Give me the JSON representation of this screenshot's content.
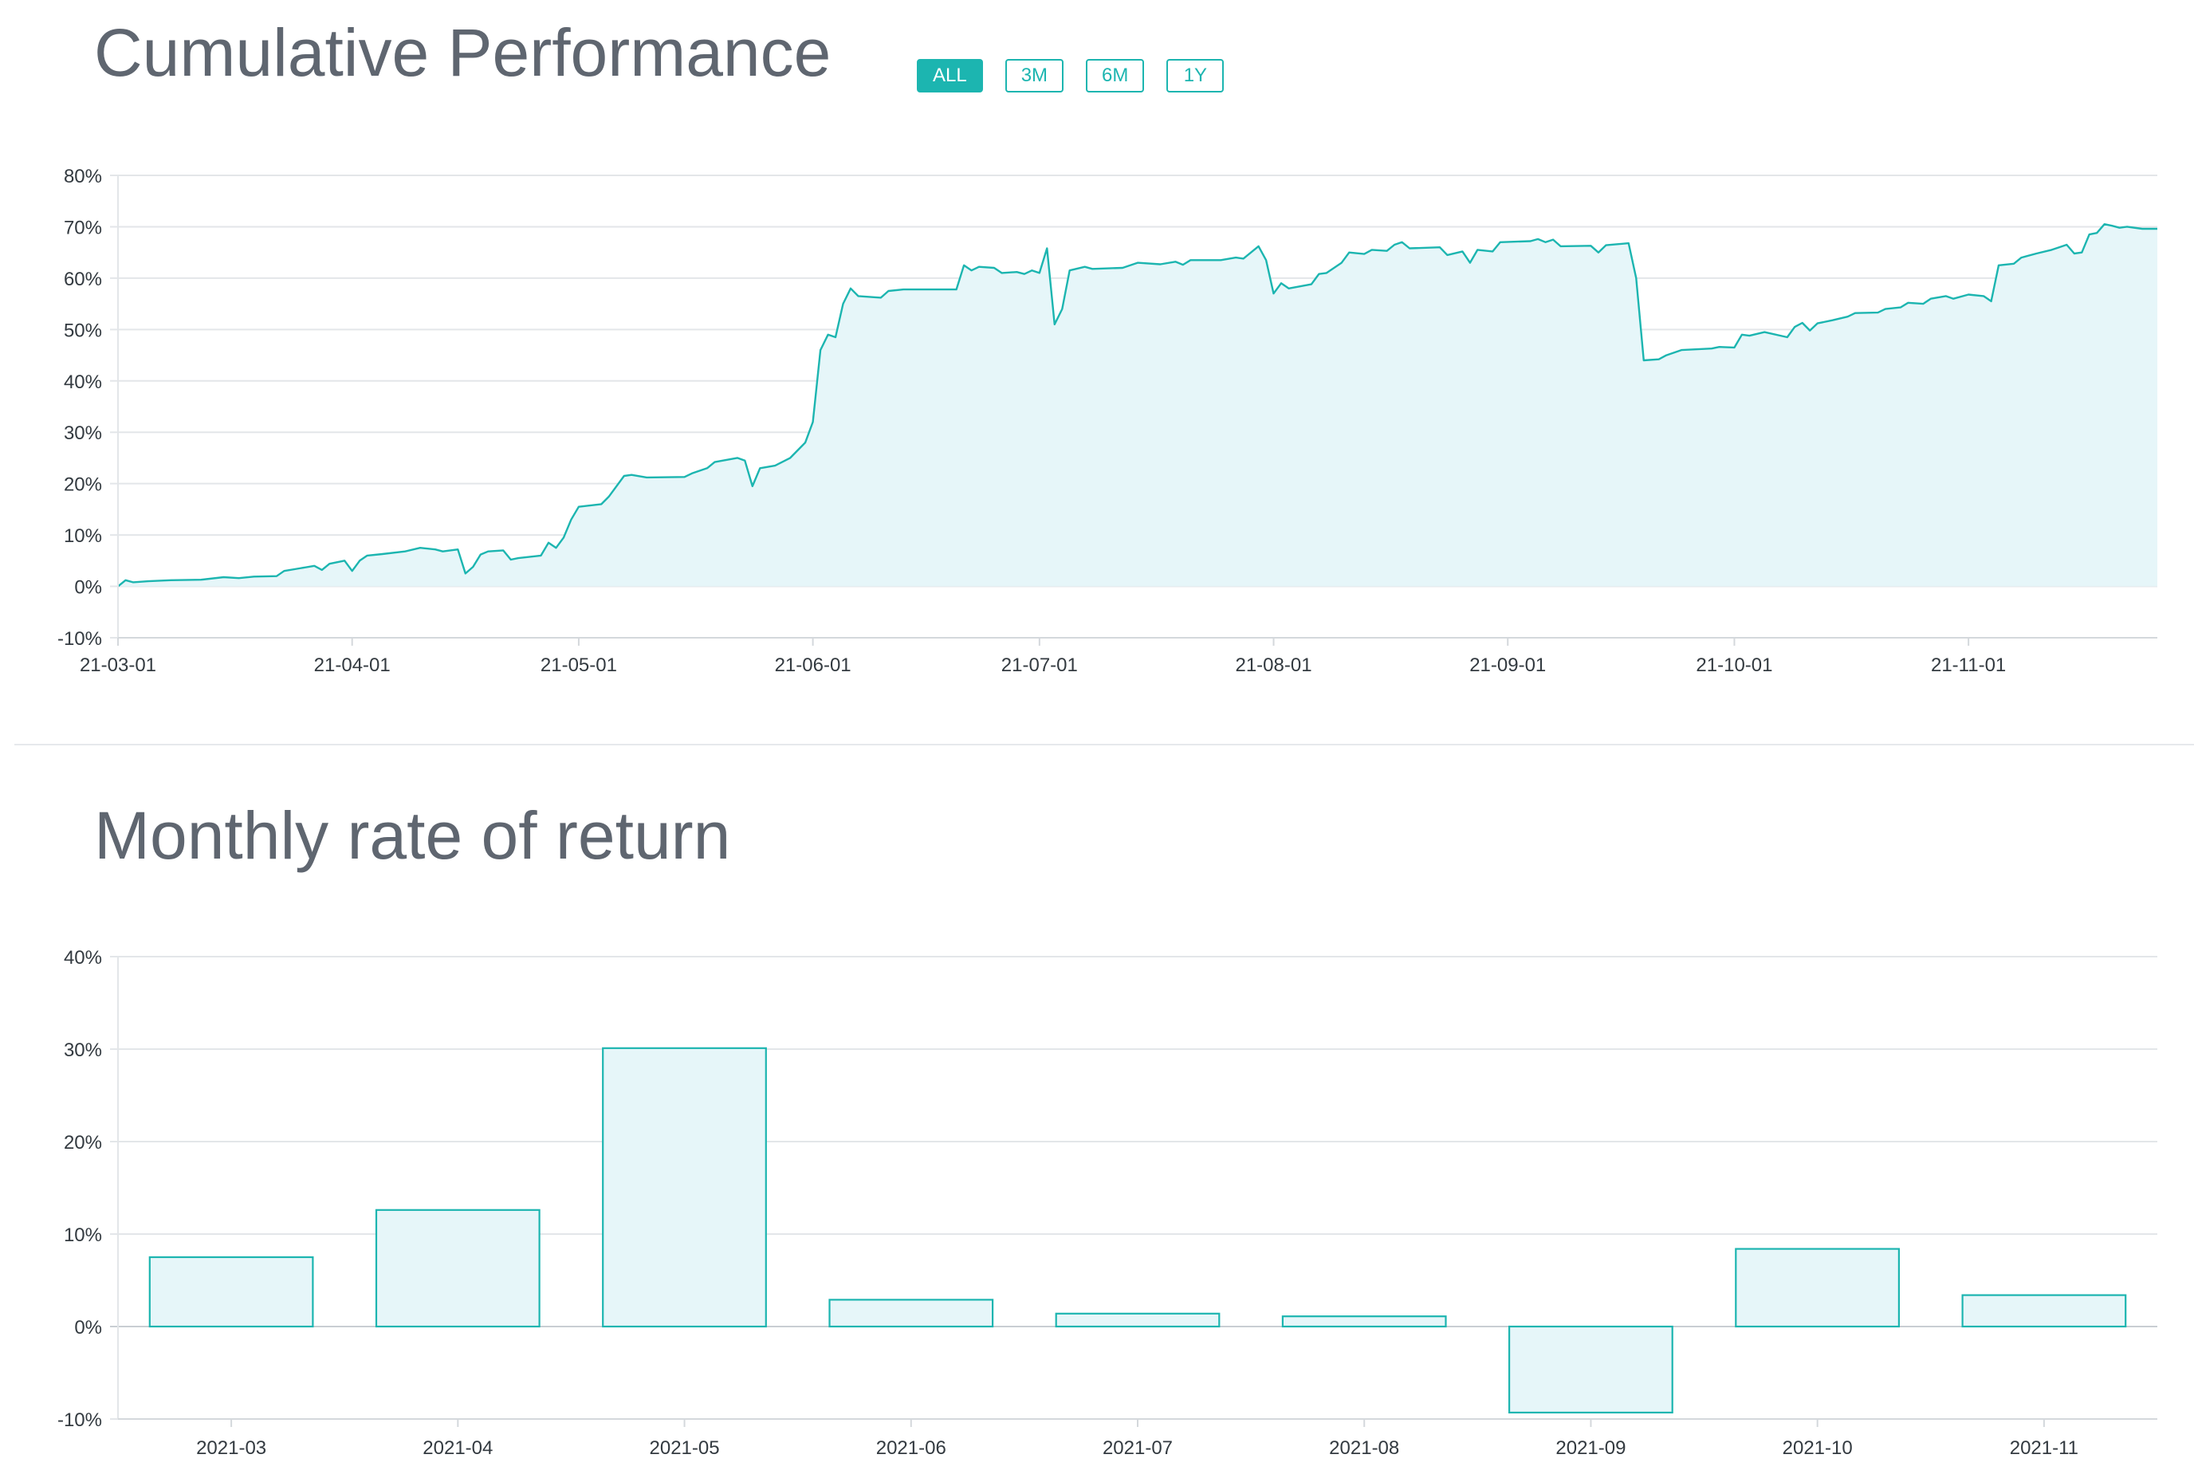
{
  "cumulative": {
    "title": "Cumulative Performance",
    "range_buttons": [
      {
        "label": "ALL",
        "active": true
      },
      {
        "label": "3M",
        "active": false
      },
      {
        "label": "6M",
        "active": false
      },
      {
        "label": "1Y",
        "active": false
      }
    ]
  },
  "monthly": {
    "title": "Monthly rate of return"
  },
  "colors": {
    "accent": "#1cb5b0",
    "fill": "#e6f6f9",
    "grid": "#e3e6e9",
    "title": "#5f6670"
  },
  "chart_data": [
    {
      "type": "area",
      "title": "",
      "xlabel": "",
      "ylabel": "",
      "ylim": [
        -10,
        80
      ],
      "y_unit": "%",
      "y_ticks": [
        -10,
        0,
        10,
        20,
        30,
        40,
        50,
        60,
        70,
        80
      ],
      "x_ticks": [
        "21-03-01",
        "21-04-01",
        "21-05-01",
        "21-06-01",
        "21-07-01",
        "21-08-01",
        "21-09-01",
        "21-10-01",
        "21-11-01"
      ],
      "x_tick_dates": [
        "2021-03-01",
        "2021-04-01",
        "2021-05-01",
        "2021-06-01",
        "2021-07-01",
        "2021-08-01",
        "2021-09-01",
        "2021-10-01",
        "2021-11-01"
      ],
      "x_range": [
        "2021-03-01",
        "2021-11-26"
      ],
      "grid": true,
      "legend": "none",
      "series": [
        {
          "points": [
            [
              "2021-03-01",
              0
            ],
            [
              "2021-03-02",
              1.2
            ],
            [
              "2021-03-03",
              0.8
            ],
            [
              "2021-03-05",
              1.0
            ],
            [
              "2021-03-08",
              1.2
            ],
            [
              "2021-03-12",
              1.3
            ],
            [
              "2021-03-15",
              1.8
            ],
            [
              "2021-03-17",
              1.6
            ],
            [
              "2021-03-19",
              1.9
            ],
            [
              "2021-03-22",
              2.0
            ],
            [
              "2021-03-23",
              3.0
            ],
            [
              "2021-03-25",
              3.5
            ],
            [
              "2021-03-27",
              4.0
            ],
            [
              "2021-03-28",
              3.2
            ],
            [
              "2021-03-29",
              4.4
            ],
            [
              "2021-03-31",
              5.0
            ],
            [
              "2021-04-01",
              3.0
            ],
            [
              "2021-04-02",
              5.0
            ],
            [
              "2021-04-03",
              6.0
            ],
            [
              "2021-04-05",
              6.3
            ],
            [
              "2021-04-08",
              6.8
            ],
            [
              "2021-04-10",
              7.5
            ],
            [
              "2021-04-12",
              7.2
            ],
            [
              "2021-04-13",
              6.8
            ],
            [
              "2021-04-15",
              7.2
            ],
            [
              "2021-04-16",
              2.5
            ],
            [
              "2021-04-17",
              3.8
            ],
            [
              "2021-04-18",
              6.2
            ],
            [
              "2021-04-19",
              6.8
            ],
            [
              "2021-04-21",
              7.0
            ],
            [
              "2021-04-22",
              5.2
            ],
            [
              "2021-04-23",
              5.5
            ],
            [
              "2021-04-26",
              6.0
            ],
            [
              "2021-04-27",
              8.5
            ],
            [
              "2021-04-28",
              7.5
            ],
            [
              "2021-04-29",
              9.5
            ],
            [
              "2021-04-30",
              13.0
            ],
            [
              "2021-05-01",
              15.5
            ],
            [
              "2021-05-04",
              16.0
            ],
            [
              "2021-05-05",
              17.5
            ],
            [
              "2021-05-07",
              21.5
            ],
            [
              "2021-05-08",
              21.7
            ],
            [
              "2021-05-10",
              21.2
            ],
            [
              "2021-05-15",
              21.3
            ],
            [
              "2021-05-16",
              22.0
            ],
            [
              "2021-05-18",
              23.0
            ],
            [
              "2021-05-19",
              24.2
            ],
            [
              "2021-05-22",
              25.0
            ],
            [
              "2021-05-23",
              24.5
            ],
            [
              "2021-05-24",
              19.5
            ],
            [
              "2021-05-25",
              23.0
            ],
            [
              "2021-05-27",
              23.5
            ],
            [
              "2021-05-29",
              25.0
            ],
            [
              "2021-05-31",
              28.0
            ],
            [
              "2021-06-01",
              32.0
            ],
            [
              "2021-06-02",
              46.0
            ],
            [
              "2021-06-03",
              49.0
            ],
            [
              "2021-06-04",
              48.5
            ],
            [
              "2021-06-05",
              55.0
            ],
            [
              "2021-06-06",
              58.0
            ],
            [
              "2021-06-07",
              56.5
            ],
            [
              "2021-06-10",
              56.2
            ],
            [
              "2021-06-11",
              57.5
            ],
            [
              "2021-06-13",
              57.8
            ],
            [
              "2021-06-20",
              57.8
            ],
            [
              "2021-06-21",
              62.5
            ],
            [
              "2021-06-22",
              61.5
            ],
            [
              "2021-06-23",
              62.2
            ],
            [
              "2021-06-25",
              62.0
            ],
            [
              "2021-06-26",
              61.0
            ],
            [
              "2021-06-28",
              61.2
            ],
            [
              "2021-06-29",
              60.8
            ],
            [
              "2021-06-30",
              61.5
            ],
            [
              "2021-07-01",
              61.0
            ],
            [
              "2021-07-02",
              65.8
            ],
            [
              "2021-07-03",
              51.0
            ],
            [
              "2021-07-04",
              54.0
            ],
            [
              "2021-07-05",
              61.5
            ],
            [
              "2021-07-07",
              62.2
            ],
            [
              "2021-07-08",
              61.8
            ],
            [
              "2021-07-12",
              62.0
            ],
            [
              "2021-07-14",
              63.0
            ],
            [
              "2021-07-17",
              62.7
            ],
            [
              "2021-07-19",
              63.2
            ],
            [
              "2021-07-20",
              62.6
            ],
            [
              "2021-07-21",
              63.5
            ],
            [
              "2021-07-25",
              63.5
            ],
            [
              "2021-07-27",
              64.0
            ],
            [
              "2021-07-28",
              63.8
            ],
            [
              "2021-07-29",
              65.0
            ],
            [
              "2021-07-30",
              66.2
            ],
            [
              "2021-07-31",
              63.5
            ],
            [
              "2021-08-01",
              57.0
            ],
            [
              "2021-08-02",
              59.0
            ],
            [
              "2021-08-03",
              58.0
            ],
            [
              "2021-08-06",
              58.8
            ],
            [
              "2021-08-07",
              60.8
            ],
            [
              "2021-08-08",
              61.0
            ],
            [
              "2021-08-10",
              63.0
            ],
            [
              "2021-08-11",
              65.0
            ],
            [
              "2021-08-13",
              64.7
            ],
            [
              "2021-08-14",
              65.5
            ],
            [
              "2021-08-16",
              65.3
            ],
            [
              "2021-08-17",
              66.5
            ],
            [
              "2021-08-18",
              67.0
            ],
            [
              "2021-08-19",
              65.8
            ],
            [
              "2021-08-23",
              66.0
            ],
            [
              "2021-08-24",
              64.5
            ],
            [
              "2021-08-26",
              65.2
            ],
            [
              "2021-08-27",
              63.0
            ],
            [
              "2021-08-28",
              65.5
            ],
            [
              "2021-08-30",
              65.2
            ],
            [
              "2021-08-31",
              67.0
            ],
            [
              "2021-09-04",
              67.2
            ],
            [
              "2021-09-05",
              67.6
            ],
            [
              "2021-09-06",
              67.0
            ],
            [
              "2021-09-07",
              67.5
            ],
            [
              "2021-09-08",
              66.2
            ],
            [
              "2021-09-12",
              66.3
            ],
            [
              "2021-09-13",
              65.0
            ],
            [
              "2021-09-14",
              66.4
            ],
            [
              "2021-09-17",
              66.8
            ],
            [
              "2021-09-18",
              60.0
            ],
            [
              "2021-09-19",
              44.0
            ],
            [
              "2021-09-21",
              44.2
            ],
            [
              "2021-09-22",
              45.0
            ],
            [
              "2021-09-24",
              46.0
            ],
            [
              "2021-09-28",
              46.3
            ],
            [
              "2021-09-29",
              46.6
            ],
            [
              "2021-10-01",
              46.5
            ],
            [
              "2021-10-02",
              49.0
            ],
            [
              "2021-10-03",
              48.8
            ],
            [
              "2021-10-05",
              49.5
            ],
            [
              "2021-10-08",
              48.5
            ],
            [
              "2021-10-09",
              50.5
            ],
            [
              "2021-10-10",
              51.3
            ],
            [
              "2021-10-11",
              49.8
            ],
            [
              "2021-10-12",
              51.2
            ],
            [
              "2021-10-14",
              51.8
            ],
            [
              "2021-10-16",
              52.5
            ],
            [
              "2021-10-17",
              53.2
            ],
            [
              "2021-10-20",
              53.3
            ],
            [
              "2021-10-21",
              54.0
            ],
            [
              "2021-10-23",
              54.3
            ],
            [
              "2021-10-24",
              55.2
            ],
            [
              "2021-10-26",
              55.0
            ],
            [
              "2021-10-27",
              56.0
            ],
            [
              "2021-10-29",
              56.5
            ],
            [
              "2021-10-30",
              56.0
            ],
            [
              "2021-11-01",
              56.8
            ],
            [
              "2021-11-03",
              56.5
            ],
            [
              "2021-11-04",
              55.5
            ],
            [
              "2021-11-05",
              62.5
            ],
            [
              "2021-11-07",
              62.8
            ],
            [
              "2021-11-08",
              64.0
            ],
            [
              "2021-11-10",
              64.8
            ],
            [
              "2021-11-12",
              65.5
            ],
            [
              "2021-11-13",
              66.0
            ],
            [
              "2021-11-14",
              66.5
            ],
            [
              "2021-11-15",
              64.8
            ],
            [
              "2021-11-16",
              65.0
            ],
            [
              "2021-11-17",
              68.5
            ],
            [
              "2021-11-18",
              68.8
            ],
            [
              "2021-11-19",
              70.5
            ],
            [
              "2021-11-20",
              70.2
            ],
            [
              "2021-11-21",
              69.8
            ],
            [
              "2021-11-22",
              70.0
            ],
            [
              "2021-11-24",
              69.6
            ],
            [
              "2021-11-26",
              69.6
            ]
          ]
        }
      ]
    },
    {
      "type": "bar",
      "title": "",
      "xlabel": "",
      "ylabel": "",
      "ylim": [
        -10,
        40
      ],
      "y_unit": "%",
      "y_ticks": [
        -10,
        0,
        10,
        20,
        30,
        40
      ],
      "categories": [
        "2021-03",
        "2021-04",
        "2021-05",
        "2021-06",
        "2021-07",
        "2021-08",
        "2021-09",
        "2021-10",
        "2021-11"
      ],
      "values": [
        7.5,
        12.6,
        30.1,
        2.9,
        1.4,
        1.1,
        -9.3,
        8.4,
        3.4
      ],
      "grid": true,
      "legend": "none"
    }
  ]
}
